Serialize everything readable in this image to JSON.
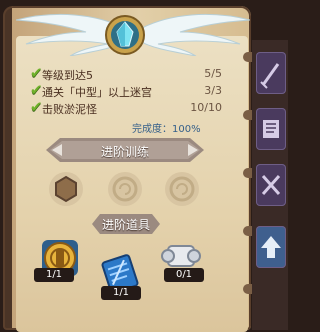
{
  "tasks": [
    {
      "label": "等级到达5",
      "progress": "5/5",
      "done": true
    },
    {
      "label": "通关「中型」以上迷宫",
      "progress": "3/3",
      "done": true
    },
    {
      "label": "击败淤泥怪",
      "progress": "10/10",
      "done": true
    }
  ],
  "completion": "完成度：100%",
  "training_banner": "进阶训练",
  "tools_banner": "进阶道具",
  "items": [
    {
      "count": "1/1",
      "icon": "gold-seal-icon"
    },
    {
      "count": "1/1",
      "icon": "blue-scroll-icon"
    },
    {
      "count": "0/1",
      "icon": "silver-scroll-icon"
    }
  ],
  "side_icons": [
    "sword-icon",
    "book-icon",
    "crossed-blades-icon",
    "up-arrow-icon"
  ],
  "colors": {
    "check": "#6fb12b",
    "completion": "#345f8a",
    "side_tab": "#4a3a5e"
  }
}
